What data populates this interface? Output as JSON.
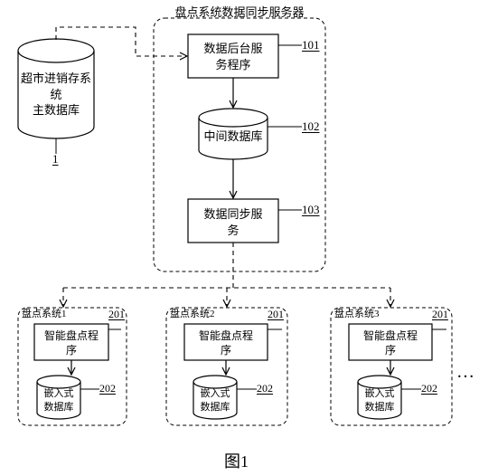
{
  "main_db": {
    "label": "超市进销存系统\n主数据库",
    "ref": "1"
  },
  "server": {
    "title": "盘点系统数据同步服务器",
    "backend": {
      "label": "数据后台服\n务程序",
      "ref": "101"
    },
    "mid_db": {
      "label": "中间数据库",
      "ref": "102"
    },
    "sync_svc": {
      "label": "数据同步服\n务",
      "ref": "103"
    }
  },
  "clients": {
    "titles": [
      "盘点系统1",
      "盘点系统2",
      "盘点系统3"
    ],
    "prog": {
      "label": "智能盘点程\n序",
      "ref": "201"
    },
    "db": {
      "label": "嵌入式\n数据库",
      "ref": "202"
    }
  },
  "ellipsis": "…",
  "figure_caption": "图1"
}
